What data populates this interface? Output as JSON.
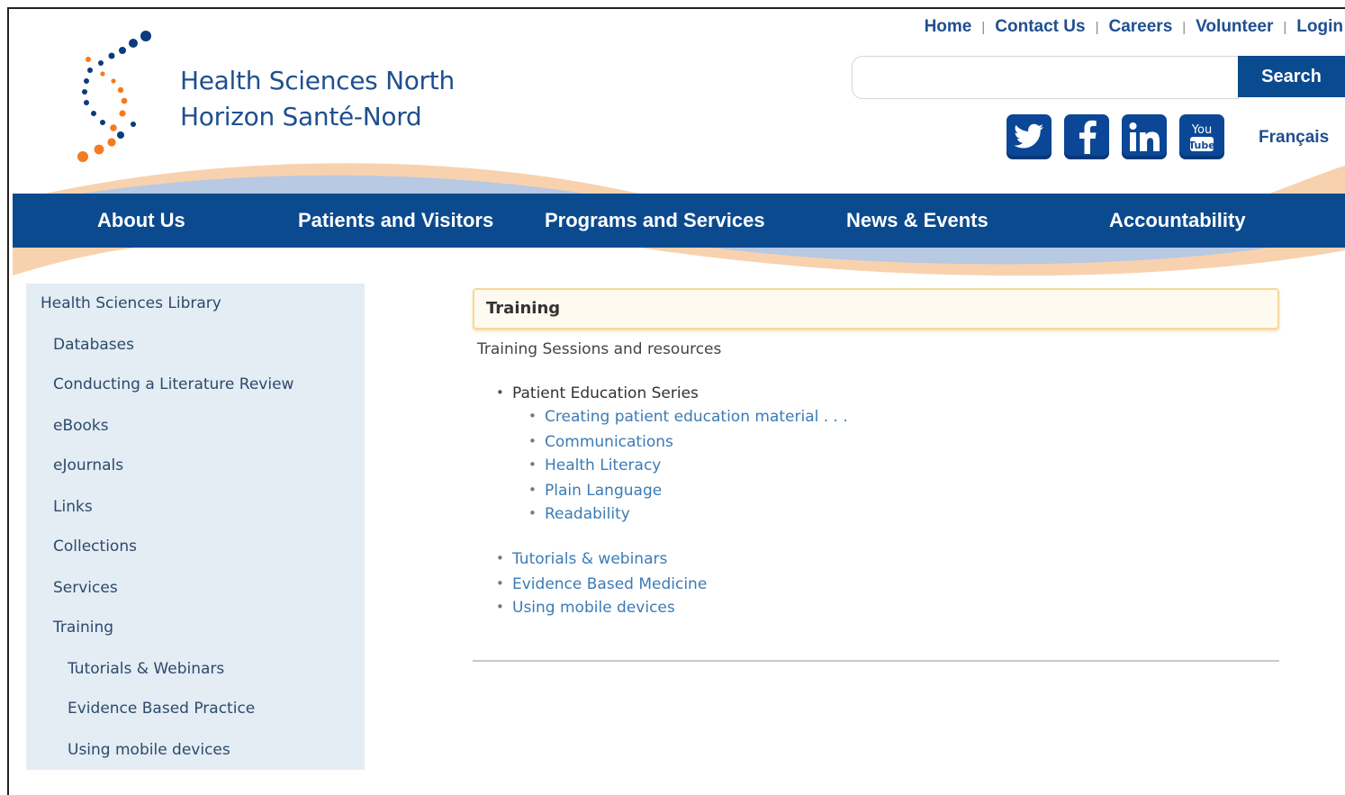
{
  "header": {
    "logo_line1": "Health Sciences North",
    "logo_line2": "Horizon Santé-Nord",
    "top_links": [
      "Home",
      "Contact Us",
      "Careers",
      "Volunteer",
      "Login"
    ],
    "search": {
      "placeholder": "",
      "value": "",
      "button_label": "Search"
    },
    "social": [
      "twitter-icon",
      "facebook-icon",
      "linkedin-icon",
      "youtube-icon"
    ],
    "language_link": "Français"
  },
  "nav": {
    "items": [
      "About Us",
      "Patients and Visitors",
      "Programs and Services",
      "News & Events",
      "Accountability"
    ]
  },
  "sidebar": {
    "items": [
      "Health Sciences Library",
      "Databases",
      "Conducting a Literature Review",
      "eBooks",
      "eJournals",
      "Links",
      "Collections",
      "Services",
      "Training",
      "Tutorials & Webinars",
      "Evidence Based Practice",
      "Using mobile devices"
    ]
  },
  "content": {
    "title": "Training",
    "intro": "Training Sessions and resources",
    "patient_education": "Patient Education Series",
    "sub_items": [
      "Creating patient education material . . .",
      "Communications",
      "Health Literacy",
      "Plain Language",
      "Readability"
    ],
    "more_items": [
      "Tutorials & webinars",
      "Evidence Based Medicine",
      "Using mobile devices"
    ]
  },
  "colors": {
    "brand_blue": "#0b4a8e",
    "brand_orange": "#f47b20",
    "sidebar_bg": "#e4ecf4",
    "link": "#3b7bb5"
  }
}
